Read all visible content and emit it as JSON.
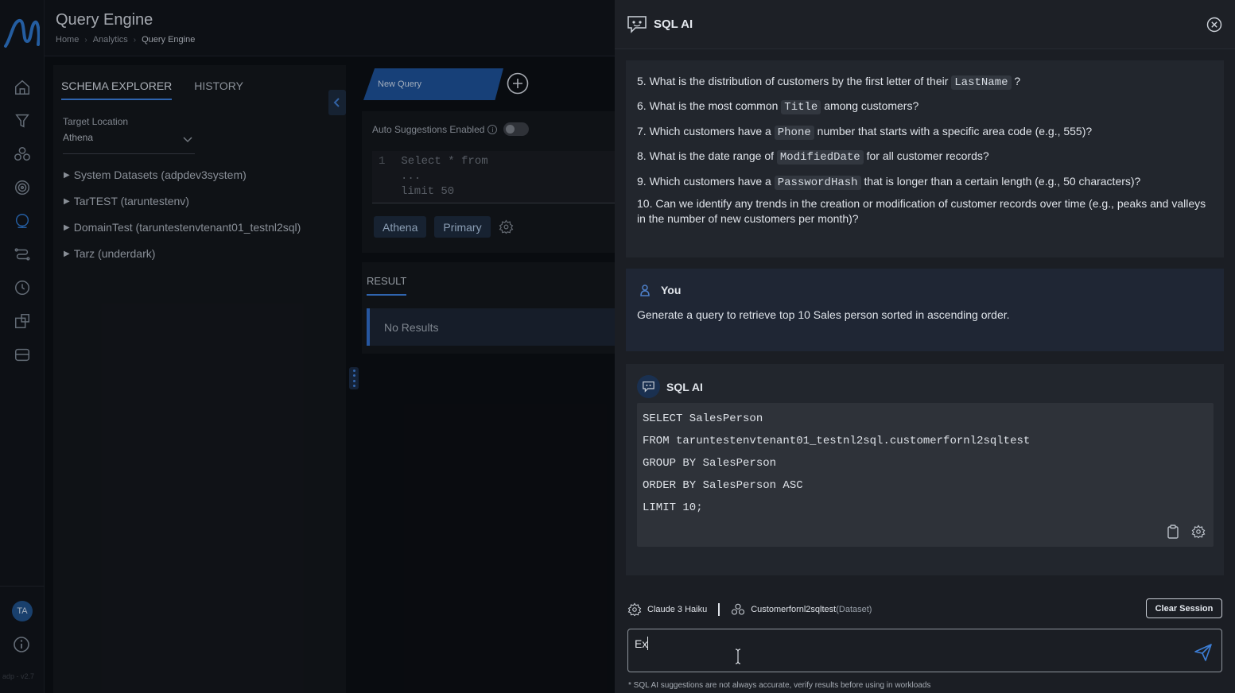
{
  "header": {
    "title": "Query Engine",
    "breadcrumbs": [
      "Home",
      "Analytics",
      "Query Engine"
    ]
  },
  "rail": {
    "nav_icons": [
      "home-icon",
      "funnel-icon",
      "nodes-icon",
      "target-icon",
      "query-icon",
      "pipeline-icon",
      "clock-icon",
      "puzzle-icon",
      "storage-icon"
    ],
    "active_index": 4,
    "avatar": "TA",
    "version": "adp - v2.7"
  },
  "schema": {
    "tabs": [
      "SCHEMA EXPLORER",
      "HISTORY"
    ],
    "active_tab": 0,
    "target_label": "Target Location",
    "target_value": "Athena",
    "tree": [
      "System Datasets (adpdev3system)",
      "TarTEST (taruntestenv)",
      "DomainTest (taruntestenvtenant01_testnl2sql)",
      "Tarz (underdark)"
    ]
  },
  "editor": {
    "tab_label": "New Query",
    "auto_suggestions_label": "Auto Suggestions Enabled",
    "auto_suggestions_on": false,
    "line_number": "1",
    "code_lines": [
      "Select * from",
      "...",
      "limit 50"
    ],
    "chips": [
      "Athena",
      "Primary"
    ]
  },
  "result": {
    "tab_label": "RESULT",
    "empty_text": "No Results"
  },
  "panel": {
    "title": "SQL AI",
    "questions": [
      {
        "parts": [
          "5. What is the distribution of customers by the first letter of their ",
          {
            "token": "LastName"
          },
          " ?"
        ]
      },
      {
        "parts": [
          "6. What is the most common ",
          {
            "token": "Title"
          },
          " among customers?"
        ]
      },
      {
        "parts": [
          "7. Which customers have a ",
          {
            "token": "Phone"
          },
          " number that starts with a specific area code (e.g., 555)?"
        ]
      },
      {
        "parts": [
          "8. What is the date range of ",
          {
            "token": "ModifiedDate"
          },
          " for all customer records?"
        ]
      },
      {
        "parts": [
          "9. Which customers have a ",
          {
            "token": "PasswordHash"
          },
          " that is longer than a certain length (e.g., 50 characters)?"
        ]
      }
    ],
    "question10_line1": "10. Can we identify any trends in the creation or modification of customer records over time (e.g., peaks and valleys",
    "question10_line2": "in the number of new customers per month)?",
    "user_label": "You",
    "user_message": "Generate a query to retrieve top 10 Sales person sorted in ascending order.",
    "ai_label": "SQL AI",
    "sql_lines": [
      "SELECT SalesPerson",
      "FROM taruntestenvtenant01_testnl2sql.customerfornl2sqltest",
      "GROUP BY SalesPerson",
      "ORDER BY SalesPerson ASC",
      "LIMIT 10;"
    ],
    "model": "Claude 3 Haiku",
    "dataset_name": "Customerfornl2sqltest",
    "dataset_type": "(Dataset)",
    "clear_label": "Clear Session",
    "input_value": "Ex",
    "disclaimer": "* SQL AI suggestions are not always accurate, verify results before using in workloads"
  },
  "colors": {
    "accent": "#2d72c4",
    "panel_bg": "#1b1e24",
    "user_card_bg": "#1f2634"
  }
}
